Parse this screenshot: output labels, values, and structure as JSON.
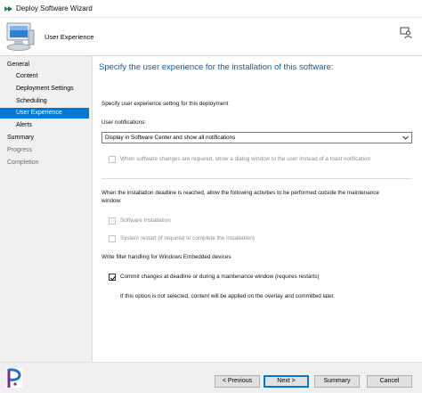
{
  "window": {
    "title": "Deploy Software Wizard"
  },
  "header": {
    "page_name": "User Experience"
  },
  "nav": {
    "items": [
      {
        "label": "General",
        "level": 0,
        "state": "normal"
      },
      {
        "label": "Content",
        "level": 1,
        "state": "normal"
      },
      {
        "label": "Deployment Settings",
        "level": 1,
        "state": "normal"
      },
      {
        "label": "Scheduling",
        "level": 1,
        "state": "normal"
      },
      {
        "label": "User Experience",
        "level": 1,
        "state": "active"
      },
      {
        "label": "Alerts",
        "level": 1,
        "state": "normal"
      },
      {
        "label": "Summary",
        "level": 0,
        "state": "normal"
      },
      {
        "label": "Progress",
        "level": 0,
        "state": "muted"
      },
      {
        "label": "Completion",
        "level": 0,
        "state": "muted"
      }
    ]
  },
  "main": {
    "heading": "Specify the user experience for the installation of this software:",
    "intro": "Specify user experience setting for this deployment",
    "notifications_label": "User notifications:",
    "notifications_value": "Display in Software Center and show all notifications",
    "toast_option": {
      "label": "When software changes are required, show a dialog window to the user instead of a toast notification",
      "checked": false,
      "enabled": false
    },
    "deadline_text_1": "When the installation deadline is reached, allow the following activities to be performed outside the maintenance",
    "deadline_text_2": "window:",
    "software_install": {
      "label": "Software Installation",
      "checked": false,
      "enabled": false
    },
    "system_restart": {
      "label": "System restart   (if required to complete the installation)",
      "checked": false,
      "enabled": false
    },
    "write_filter_label": "Write filter handling for Windows Embedded devices",
    "commit_changes": {
      "label": "Commit changes at deadline or during a maintenance window (requires restarts)",
      "checked": true,
      "enabled": true
    },
    "commit_note": "If this option is not selected, content will be applied on the overlay and committed later."
  },
  "footer": {
    "previous_label": "< Previous",
    "next_label": "Next >",
    "summary_label": "Summary",
    "cancel_label": "Cancel"
  },
  "colors": {
    "accent": "#0078d7",
    "heading": "#0a5ea8",
    "brand": "#7b2d8e"
  },
  "icons": [
    "app-arrow-icon",
    "computer-wizard-icon",
    "help-user-icon",
    "chevron-down-icon",
    "checkmark-icon",
    "brand-logo-icon"
  ]
}
